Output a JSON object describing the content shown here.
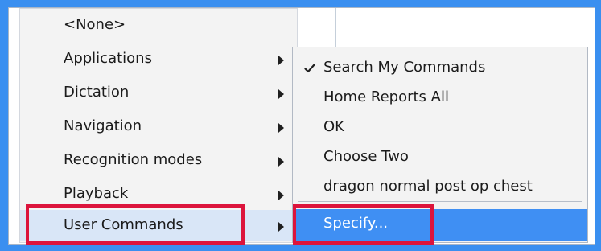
{
  "main_menu": {
    "items": [
      {
        "label": "<None>"
      },
      {
        "label": "Applications"
      },
      {
        "label": "Dictation"
      },
      {
        "label": "Navigation"
      },
      {
        "label": "Recognition modes"
      },
      {
        "label": "Playback"
      },
      {
        "label": "User Commands"
      }
    ]
  },
  "submenu": {
    "items": [
      {
        "label": "Search My Commands",
        "checked": true
      },
      {
        "label": "Home Reports All",
        "checked": false
      },
      {
        "label": "OK",
        "checked": false
      },
      {
        "label": "Choose Two",
        "checked": false
      },
      {
        "label": "dragon normal post op chest",
        "checked": false
      },
      {
        "label": "Specify...",
        "checked": false
      }
    ]
  },
  "colors": {
    "background": "#3a8ff0",
    "menu_background": "#f3f3f3",
    "selected_item": "#3f8ff3",
    "highlight_frame": "#dc143c"
  }
}
